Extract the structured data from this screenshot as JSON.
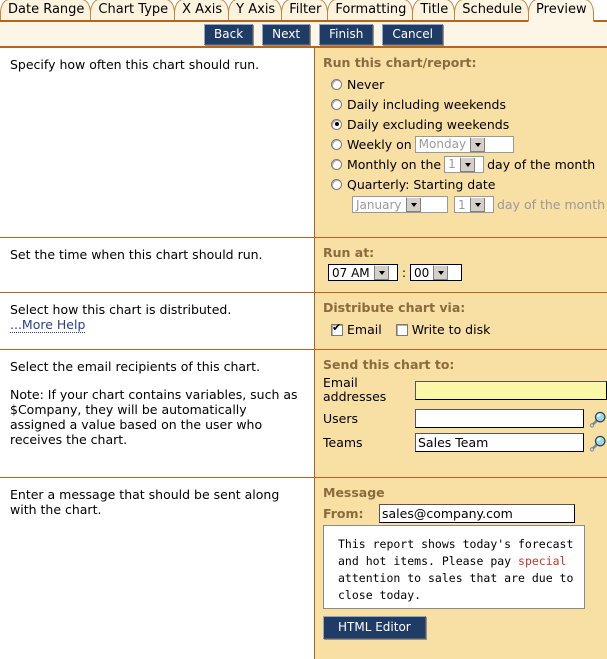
{
  "tabs": [
    {
      "label": "Date Range",
      "active": false
    },
    {
      "label": "Chart Type",
      "active": false
    },
    {
      "label": "X Axis",
      "active": false
    },
    {
      "label": "Y Axis",
      "active": false
    },
    {
      "label": "Filter",
      "active": false
    },
    {
      "label": "Formatting",
      "active": false
    },
    {
      "label": "Title",
      "active": false
    },
    {
      "label": "Schedule",
      "active": false
    },
    {
      "label": "Preview",
      "active": true
    }
  ],
  "buttons": {
    "back": "Back",
    "next": "Next",
    "finish": "Finish",
    "cancel": "Cancel"
  },
  "rows": {
    "schedule": {
      "left_text": "Specify how often this chart should run.",
      "header": "Run this chart/report:",
      "options": [
        {
          "label": "Never",
          "selected": false
        },
        {
          "label": "Daily including weekends",
          "selected": false
        },
        {
          "label": "Daily excluding weekends",
          "selected": true
        },
        {
          "label": "Weekly on",
          "selected": false
        },
        {
          "label": "Monthly on the",
          "selected": false
        },
        {
          "label": "Quarterly: Starting date",
          "selected": false
        }
      ],
      "weekly_day": "Monday",
      "monthly_day": "1",
      "monthly_suffix": "day of the month",
      "quarterly_month": "January",
      "quarterly_day": "1",
      "quarterly_suffix": "day of the month"
    },
    "runat": {
      "left_text": "Set the time when this chart should run.",
      "header": "Run at:",
      "hour": "07 AM",
      "separator": ":",
      "minute": "00"
    },
    "distribute": {
      "left_text": "Select how this chart is distributed.",
      "help_link": "...More Help",
      "header": "Distribute chart via:",
      "email_label": "Email",
      "email_checked": true,
      "disk_label": "Write to disk",
      "disk_checked": false
    },
    "recipients": {
      "left_text": "Select the email recipients of this chart.",
      "left_note": "Note: If your chart contains variables, such as $Company, they will be automatically assigned a value based on the user who receives the chart.",
      "header": "Send this chart to:",
      "email_label": "Email addresses",
      "email_value": "",
      "users_label": "Users",
      "users_value": "",
      "teams_label": "Teams",
      "teams_value": "Sales Team",
      "lookup_icon": "magnifier-icon"
    },
    "message": {
      "left_text": "Enter a message that should be sent along with the chart.",
      "header": "Message",
      "from_label": "From:",
      "from_value": "sales@company.com",
      "body_part1": "This report shows today's forecast and hot items. Please pay ",
      "body_highlight": "special",
      "body_part2": " attention to sales that are due to close today.",
      "editor_button": "HTML Editor"
    }
  },
  "colors": {
    "panel_bg": "#F8DFA4",
    "tab_bg": "#FCF3DF",
    "border": "#B5651D",
    "section_header": "#8B6B3D",
    "button_bg": "#1F3C66",
    "highlight_text": "#C0392B",
    "focus_field_bg": "#FBF7A8",
    "link": "#2A3F8F"
  }
}
